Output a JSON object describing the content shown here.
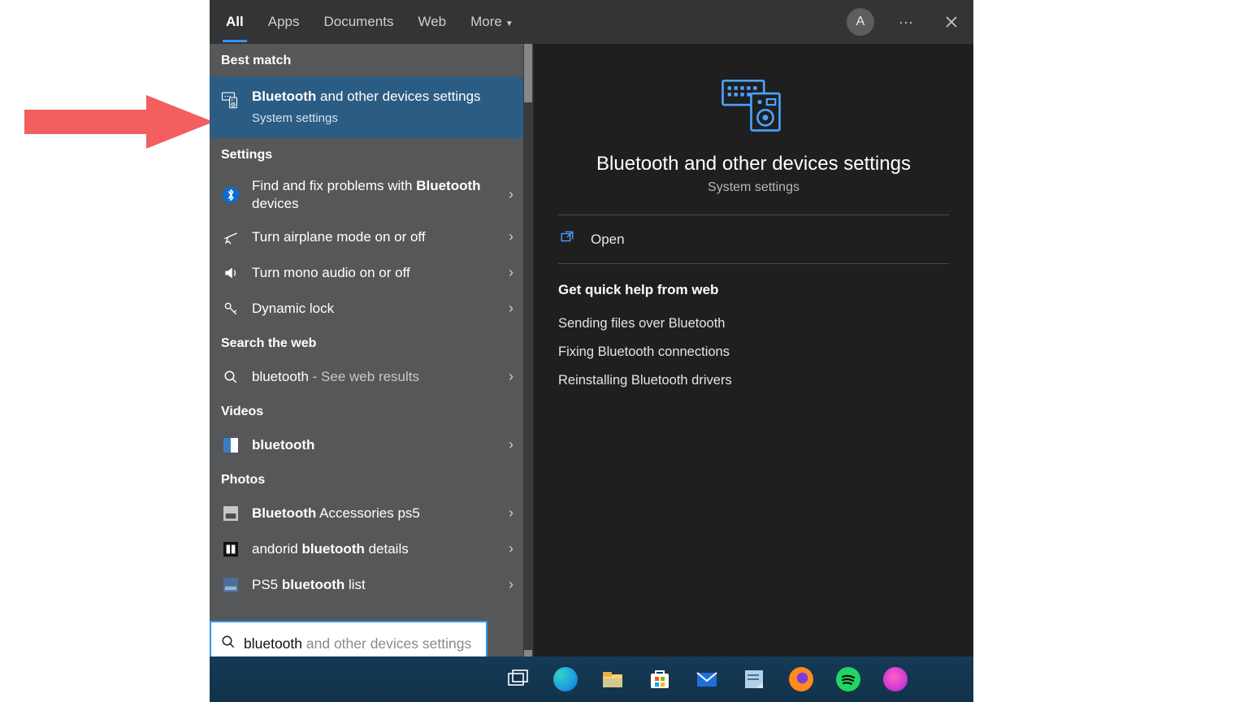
{
  "annotation": {
    "arrow_color": "#f35e5e"
  },
  "tabs": {
    "items": [
      "All",
      "Apps",
      "Documents",
      "Web",
      "More"
    ],
    "active_index": 0,
    "avatar_initial": "A"
  },
  "left": {
    "best_match_header": "Best match",
    "best": {
      "title_bold": "Bluetooth",
      "title_rest": " and other devices settings",
      "subtitle": "System settings"
    },
    "settings_header": "Settings",
    "settings_items": [
      {
        "icon": "bt-circle",
        "line1_pre": "Find and fix problems with ",
        "line1_bold": "Bluetooth",
        "line1_post": " devices"
      },
      {
        "icon": "airplane",
        "line1_pre": "Turn airplane mode on or off",
        "line1_bold": "",
        "line1_post": ""
      },
      {
        "icon": "speaker",
        "line1_pre": "Turn mono audio on or off",
        "line1_bold": "",
        "line1_post": ""
      },
      {
        "icon": "key",
        "line1_pre": "Dynamic lock",
        "line1_bold": "",
        "line1_post": ""
      }
    ],
    "web_header": "Search the web",
    "web_item": {
      "term": "bluetooth",
      "suffix": " - See web results"
    },
    "videos_header": "Videos",
    "video_item": {
      "bold": "bluetooth",
      "rest": ""
    },
    "photos_header": "Photos",
    "photo_items": [
      {
        "pre": "",
        "bold": "Bluetooth",
        "post": " Accessories ps5"
      },
      {
        "pre": "andorid ",
        "bold": "bluetooth",
        "post": " details"
      },
      {
        "pre": "PS5 ",
        "bold": "bluetooth",
        "post": " list"
      }
    ]
  },
  "right": {
    "title": "Bluetooth and other devices settings",
    "subtitle": "System settings",
    "open_label": "Open",
    "help_header": "Get quick help from web",
    "help_links": [
      "Sending files over Bluetooth",
      "Fixing Bluetooth connections",
      "Reinstalling Bluetooth drivers"
    ]
  },
  "search": {
    "typed": "bluetooth",
    "ghost": " and other devices settings"
  },
  "taskbar": {
    "icons": [
      "task-view",
      "edge",
      "file-explorer",
      "ms-store",
      "mail",
      "sticky-notes",
      "firefox",
      "spotify",
      "app-pink"
    ]
  }
}
